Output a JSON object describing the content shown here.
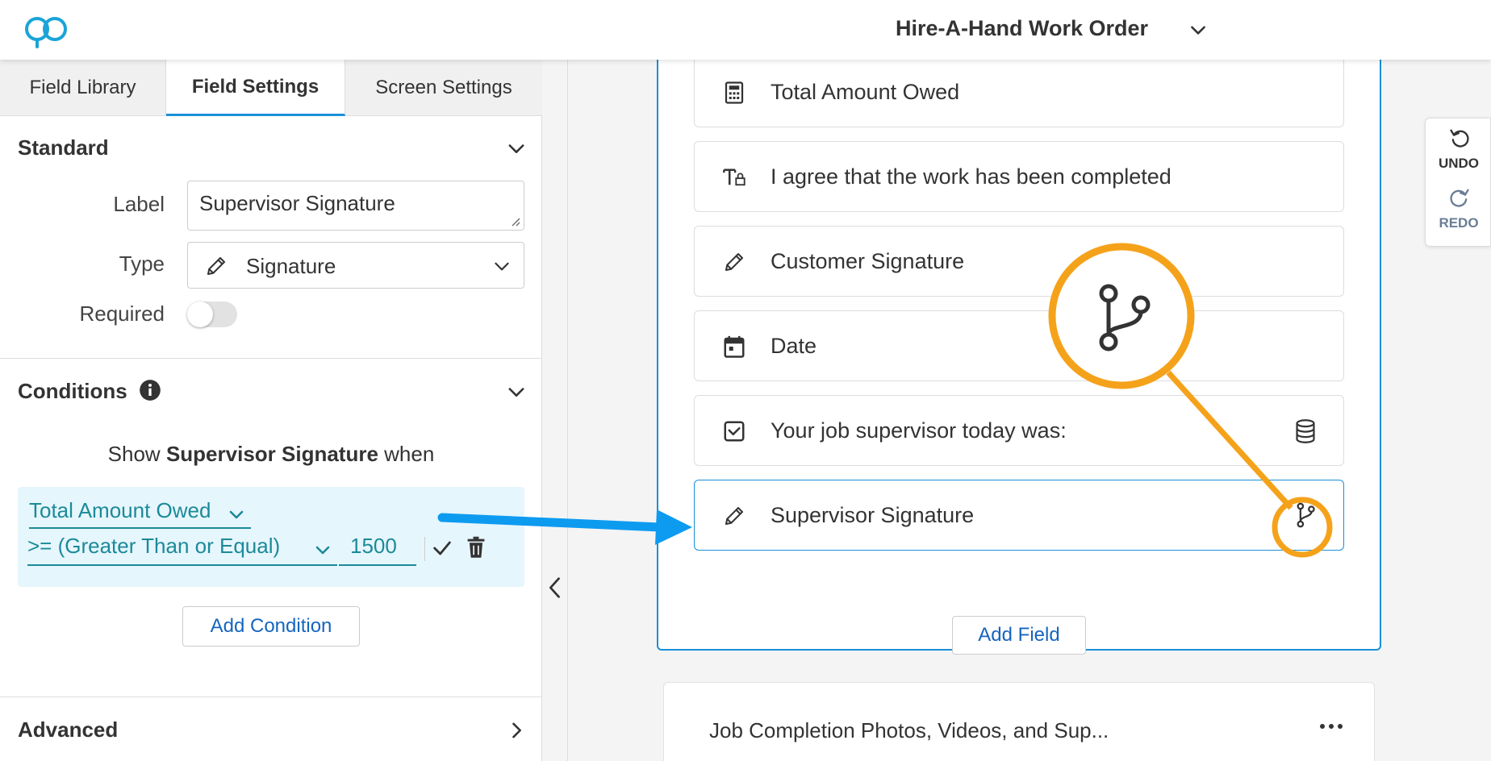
{
  "header": {
    "form_title": "Hire-A-Hand Work Order"
  },
  "left_panel": {
    "tabs": [
      {
        "label": "Field Library"
      },
      {
        "label": "Field Settings"
      },
      {
        "label": "Screen Settings"
      }
    ],
    "standard": {
      "title": "Standard",
      "label_caption": "Label",
      "label_value": "Supervisor Signature",
      "type_caption": "Type",
      "type_value": "Signature",
      "required_caption": "Required",
      "required_on": false
    },
    "conditions": {
      "title": "Conditions",
      "show_prefix": "Show",
      "show_field": "Supervisor Signature",
      "show_suffix": "when",
      "condition": {
        "field": "Total Amount Owed",
        "operator": ">= (Greater Than or Equal)",
        "value": "1500"
      },
      "add_condition_label": "Add Condition"
    },
    "advanced": {
      "title": "Advanced"
    }
  },
  "canvas": {
    "fields": [
      {
        "label": "Total Amount Owed",
        "icon": "calculator-icon"
      },
      {
        "label": "I agree that the work has been completed",
        "icon": "text-lock-icon"
      },
      {
        "label": "Customer Signature",
        "icon": "pencil-icon"
      },
      {
        "label": "Date",
        "icon": "calendar-icon"
      },
      {
        "label": "Your job supervisor today was:",
        "icon": "checkbox-icon",
        "right_icon": "database-icon"
      },
      {
        "label": "Supervisor Signature",
        "icon": "pencil-icon",
        "right_icon": "branch-icon",
        "selected": true
      }
    ],
    "add_field_label": "Add Field",
    "next_screen_title": "Job Completion Photos, Videos, and Sup..."
  },
  "history": {
    "undo_label": "UNDO",
    "redo_label": "REDO"
  },
  "colors": {
    "accent": "#1a8fd8",
    "condition_teal": "#1b8a99",
    "callout_orange": "#f5a21b",
    "arrow_blue": "#0d9bf0"
  }
}
